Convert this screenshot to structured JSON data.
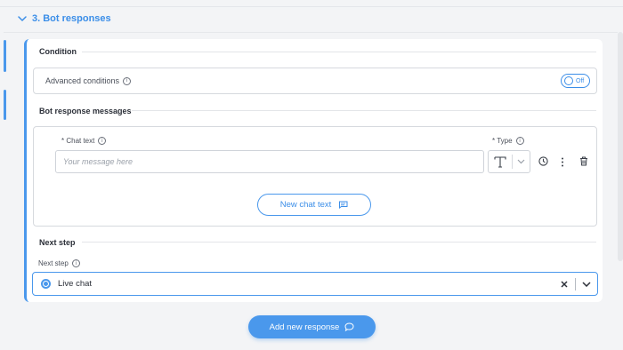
{
  "section": {
    "title": "3. Bot responses"
  },
  "condition": {
    "heading": "Condition",
    "advanced_label": "Advanced conditions",
    "toggle_label": "Off"
  },
  "messages": {
    "heading": "Bot response messages",
    "chat_text_label": "* Chat text",
    "chat_text_placeholder": "Your message here",
    "chat_text_value": "",
    "type_label": "* Type",
    "new_chat_button": "New chat text"
  },
  "next_step": {
    "heading": "Next step",
    "field_label": "Next step",
    "selected_value": "Live chat"
  },
  "add_response_button": "Add new response",
  "colors": {
    "accent": "#4a98ec",
    "text": "#2b2f38",
    "border": "#d6d9de"
  }
}
